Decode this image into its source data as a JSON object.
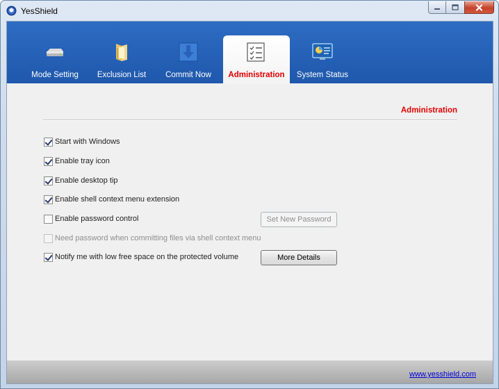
{
  "window": {
    "title": "YesShield",
    "icon": "shield-app-icon"
  },
  "tabs": [
    {
      "label": "Mode Setting",
      "icon": "drive-icon",
      "active": false
    },
    {
      "label": "Exclusion List",
      "icon": "folder-icon",
      "active": false
    },
    {
      "label": "Commit Now",
      "icon": "commit-arrow-icon",
      "active": false
    },
    {
      "label": "Administration",
      "icon": "checklist-icon",
      "active": true
    },
    {
      "label": "System Status",
      "icon": "monitor-icon",
      "active": false
    }
  ],
  "content": {
    "section_title": "Administration",
    "options": [
      {
        "label": "Start with Windows",
        "checked": true,
        "enabled": true
      },
      {
        "label": "Enable tray icon",
        "checked": true,
        "enabled": true
      },
      {
        "label": "Enable desktop tip",
        "checked": true,
        "enabled": true
      },
      {
        "label": "Enable shell context menu extension",
        "checked": true,
        "enabled": true
      },
      {
        "label": "Enable password control",
        "checked": false,
        "enabled": true
      },
      {
        "label": "Need password when committing files via shell context menu",
        "checked": false,
        "enabled": false
      },
      {
        "label": "Notify me with low free space on the protected volume",
        "checked": true,
        "enabled": true
      }
    ],
    "set_password_button": "Set New Password",
    "more_details_button": "More Details"
  },
  "footer": {
    "link": "www.yesshield.com"
  },
  "colors": {
    "tabbar": "#2366ba",
    "active_tab_text": "#e00000",
    "link": "#0000d8"
  }
}
